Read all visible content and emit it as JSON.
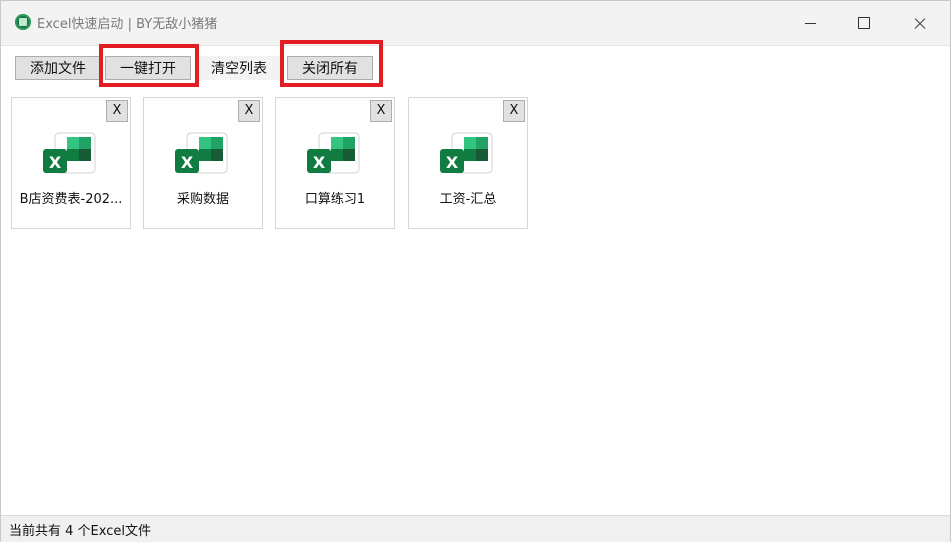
{
  "window": {
    "title": "Excel快速启动 | BY无敌小猪猪",
    "icon": "excel-app-icon"
  },
  "toolbar": {
    "add_label": "添加文件",
    "open_all_label": "一键打开",
    "clear_label": "清空列表",
    "close_all_label": "关闭所有"
  },
  "files": [
    {
      "name": "B店资费表-202...",
      "remove_label": "X"
    },
    {
      "name": "采购数据",
      "remove_label": "X"
    },
    {
      "name": "口算练习1",
      "remove_label": "X"
    },
    {
      "name": "工资-汇总",
      "remove_label": "X"
    }
  ],
  "status": {
    "text": "当前共有 4 个Excel文件"
  },
  "colors": {
    "highlight": "#e31d24",
    "excel_green": "#1e7145"
  }
}
